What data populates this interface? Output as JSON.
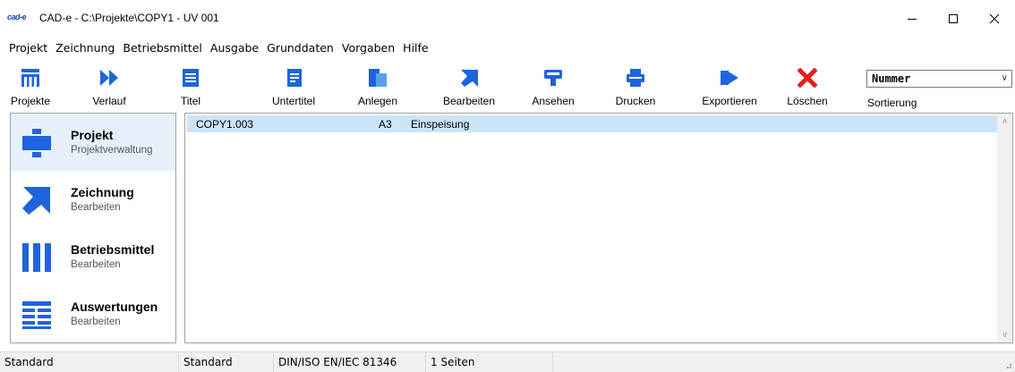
{
  "window": {
    "logo_text": "cad-e",
    "title": "CAD-e - C:\\Projekte\\COPY1 - UV 001"
  },
  "menu": [
    "Projekt",
    "Zeichnung",
    "Betriebsmittel",
    "Ausgabe",
    "Grunddaten",
    "Vorgaben",
    "Hilfe"
  ],
  "toolbar": {
    "buttons": [
      {
        "label": "Projekte",
        "icon": "projects-icon"
      },
      {
        "label": "Verlauf",
        "icon": "history-icon"
      },
      {
        "label": "Titel",
        "icon": "title-icon"
      },
      {
        "label": "Untertitel",
        "icon": "subtitle-icon"
      },
      {
        "label": "Anlegen",
        "icon": "create-icon"
      },
      {
        "label": "Bearbeiten",
        "icon": "edit-icon"
      },
      {
        "label": "Ansehen",
        "icon": "view-icon"
      },
      {
        "label": "Drucken",
        "icon": "print-icon"
      },
      {
        "label": "Exportieren",
        "icon": "export-icon"
      },
      {
        "label": "Löschen",
        "icon": "delete-icon"
      }
    ],
    "sort_value": "Nummer",
    "sort_label": "Sortierung"
  },
  "nav": [
    {
      "title": "Projekt",
      "subtitle": "Projektverwaltung",
      "icon": "project-icon",
      "active": true
    },
    {
      "title": "Zeichnung",
      "subtitle": "Bearbeiten",
      "icon": "drawing-icon",
      "active": false
    },
    {
      "title": "Betriebsmittel",
      "subtitle": "Bearbeiten",
      "icon": "equipment-icon",
      "active": false
    },
    {
      "title": "Auswertungen",
      "subtitle": "Bearbeiten",
      "icon": "reports-icon",
      "active": false
    }
  ],
  "list": {
    "rows": [
      {
        "name": "COPY1.003",
        "format": "A3",
        "description": "Einspeisung"
      }
    ]
  },
  "status": {
    "cells": [
      "Standard",
      "Standard",
      "DIN/ISO EN/IEC 81346",
      "1 Seiten"
    ]
  },
  "colors": {
    "accent_blue": "#1e64dc",
    "delete_red": "#e61e1e",
    "selection": "#cce4f7"
  }
}
